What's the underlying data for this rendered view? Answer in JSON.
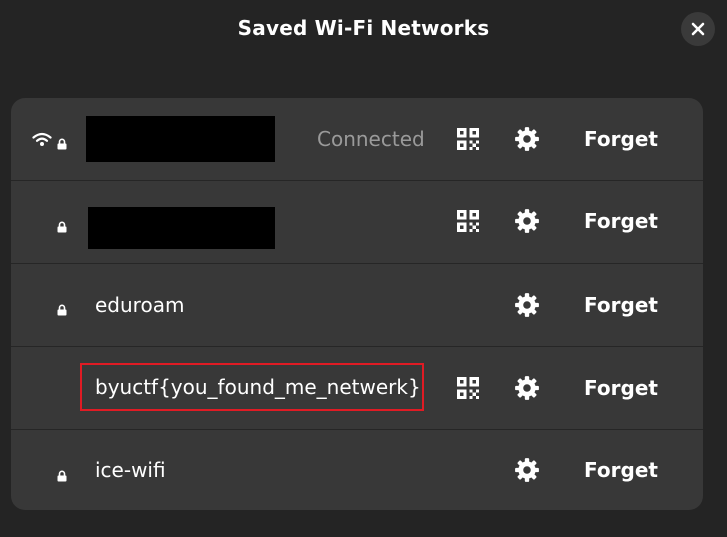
{
  "dialog": {
    "title": "Saved Wi-Fi Networks",
    "close_icon": "close-icon"
  },
  "colors": {
    "background": "#242424",
    "list_background": "#383838",
    "status_text": "#9a9a9a",
    "highlight": "#e01b24"
  },
  "networks": [
    {
      "name": "",
      "name_redacted": true,
      "status": "Connected",
      "connected": true,
      "secured": true,
      "has_qr": true,
      "forget_label": "Forget"
    },
    {
      "name": "",
      "name_redacted": true,
      "status": "",
      "connected": false,
      "secured": true,
      "has_qr": true,
      "forget_label": "Forget"
    },
    {
      "name": "eduroam",
      "name_redacted": false,
      "status": "",
      "connected": false,
      "secured": true,
      "has_qr": false,
      "forget_label": "Forget"
    },
    {
      "name": "byuctf{you_found_me_netwerk}",
      "name_redacted": false,
      "status": "",
      "connected": false,
      "secured": false,
      "has_qr": true,
      "highlighted": true,
      "forget_label": "Forget"
    },
    {
      "name": "ice-wifi",
      "name_redacted": false,
      "status": "",
      "connected": false,
      "secured": true,
      "has_qr": false,
      "forget_label": "Forget"
    }
  ]
}
